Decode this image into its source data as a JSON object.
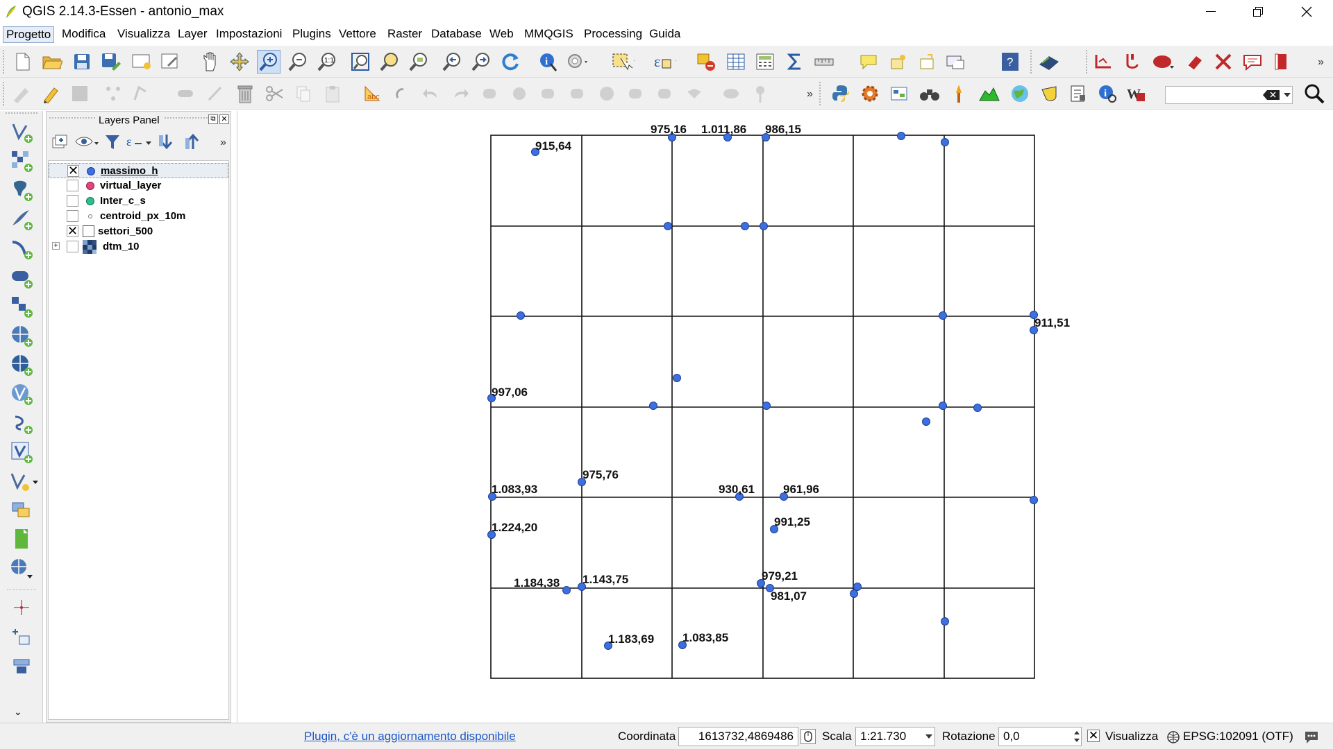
{
  "window": {
    "title": "QGIS 2.14.3-Essen - antonio_max",
    "minimize_icon": "minimize-icon",
    "restore_icon": "restore-icon",
    "close_icon": "close-icon"
  },
  "menu": [
    {
      "label": "Progetto"
    },
    {
      "label": "Modifica"
    },
    {
      "label": "Visualizza"
    },
    {
      "label": "Layer"
    },
    {
      "label": "Impostazioni"
    },
    {
      "label": "Plugins"
    },
    {
      "label": "Vettore"
    },
    {
      "label": "Raster"
    },
    {
      "label": "Database"
    },
    {
      "label": "Web"
    },
    {
      "label": "MMQGIS"
    },
    {
      "label": "Processing"
    },
    {
      "label": "Guida"
    }
  ],
  "toolbar1_icons": [
    "new-project-icon",
    "open-project-icon",
    "save-project-icon",
    "save-as-icon",
    "new-print-composer-icon",
    "composer-manager-icon",
    "pan-icon",
    "pan-to-selection-icon",
    "zoom-in-icon",
    "zoom-out-icon",
    "zoom-native-icon",
    "zoom-full-icon",
    "zoom-to-selection-icon",
    "zoom-to-layer-icon",
    "zoom-last-icon",
    "zoom-next-icon",
    "refresh-icon",
    "identify-icon",
    "action-icon",
    "select-icon",
    "deselect-icon",
    "open-attribute-table-icon",
    "field-calculator-icon",
    "statistics-icon",
    "measure-icon",
    "map-tips-icon",
    "bookmarks-icon",
    "annotation-icon",
    "help-icon",
    "plugin-icon",
    "digitize-icon"
  ],
  "toolbar2_icons": [
    "current-edits-icon",
    "toggle-editing-icon",
    "save-edits-icon",
    "add-feature-icon",
    "move-feature-icon",
    "node-tool-icon",
    "delete-selected-icon",
    "cut-features-icon",
    "copy-features-icon",
    "paste-features-icon",
    "label-icon",
    "python-console-icon",
    "processing-icon",
    "identify-features-icon",
    "search-icon"
  ],
  "search_box": {
    "value": "",
    "clear_icon": "clear-icon"
  },
  "left_toolbar_icons": [
    "add-vector-layer-icon",
    "add-raster-layer-icon",
    "add-postgis-layer-icon",
    "add-spatialite-layer-icon",
    "add-mssql-layer-icon",
    "add-oracle-layer-icon",
    "add-db2-layer-icon",
    "add-wms-layer-icon",
    "add-wcs-layer-icon",
    "add-wfs-layer-icon",
    "add-delimited-text-icon",
    "add-virtual-layer-icon",
    "new-shapefile-icon",
    "new-spatialite-icon",
    "new-gpx-icon",
    "new-memory-layer-icon",
    "add-geonode-icon",
    "capture-point-icon",
    "coordinate-capture-icon",
    "georeferencer-icon"
  ],
  "layers_panel": {
    "title": "Layers Panel",
    "layers": [
      {
        "name": "massimo_h",
        "checked": "✕",
        "symbol": "#3d6fe0",
        "symbol_type": "point"
      },
      {
        "name": "virtual_layer",
        "checked": "",
        "symbol": "#e0457b",
        "symbol_type": "point"
      },
      {
        "name": "Inter_c_s",
        "checked": "",
        "symbol": "#2ec08c",
        "symbol_type": "point"
      },
      {
        "name": "centroid_px_10m",
        "checked": "",
        "symbol": "#9aa0a6",
        "symbol_type": "small-point"
      },
      {
        "name": "settori_500",
        "checked": "✕",
        "symbol": "#ffffff",
        "symbol_type": "polygon"
      },
      {
        "name": "dtm_10",
        "checked": "",
        "symbol": "#1f3d6b",
        "symbol_type": "raster"
      }
    ]
  },
  "map": {
    "point_color": "#3d6fe0",
    "labels": [
      {
        "text": "915,64"
      },
      {
        "text": "975,16"
      },
      {
        "text": "1.011,86"
      },
      {
        "text": "986,15"
      },
      {
        "text": "911,51"
      },
      {
        "text": "997,06"
      },
      {
        "text": "975,76"
      },
      {
        "text": "1.083,93"
      },
      {
        "text": "930,61"
      },
      {
        "text": "961,96"
      },
      {
        "text": "991,25"
      },
      {
        "text": "1.224,20"
      },
      {
        "text": "979,21"
      },
      {
        "text": "1.184,38"
      },
      {
        "text": "1.143,75"
      },
      {
        "text": "981,07"
      },
      {
        "text": "1.183,69"
      },
      {
        "text": "1.083,85"
      }
    ]
  },
  "status": {
    "plugin_notice": "Plugin, c'è un aggiornamento disponibile",
    "coord_label": "Coordinata",
    "coord_value": "1613732,4869486",
    "scale_label": "Scala",
    "scale_value": "1:21.730",
    "rotation_label": "Rotazione",
    "rotation_value": "0,0",
    "render_label": "Visualizza",
    "render_checked": "✕",
    "crs": "EPSG:102091 (OTF)"
  }
}
